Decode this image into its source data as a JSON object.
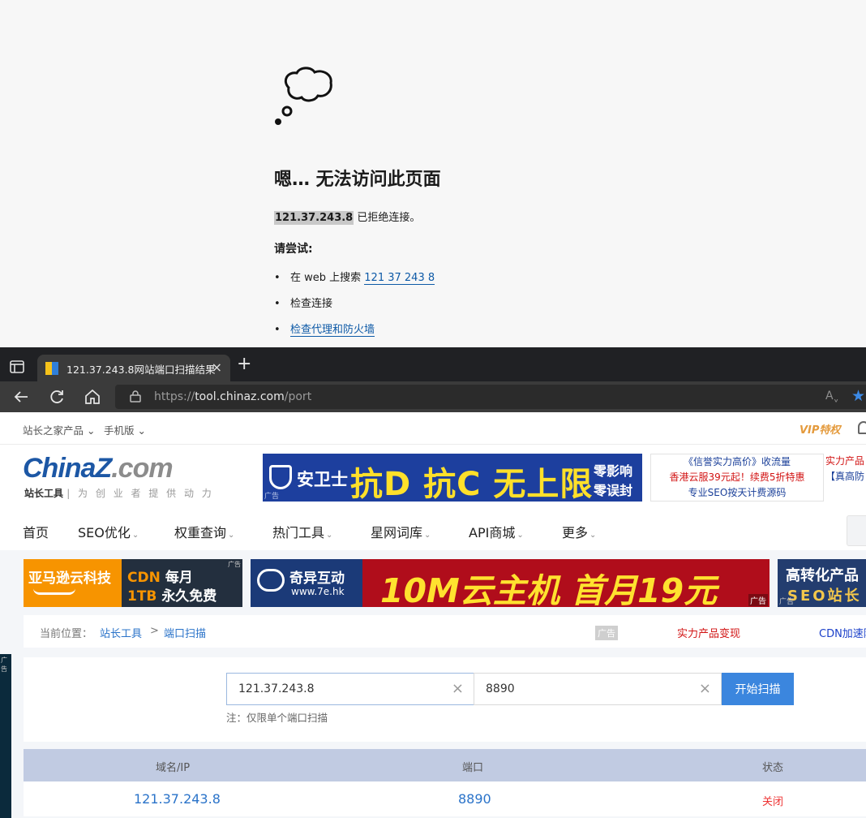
{
  "error_page": {
    "title": "嗯… 无法访问此页面",
    "ip": "121.37.243.8",
    "desc_suffix": " 已拒绝连接。",
    "try_label": "请尝试:",
    "items": [
      {
        "text": "在 web 上搜索 ",
        "link": "121 37 243 8"
      },
      {
        "text": "检查连接",
        "link": ""
      },
      {
        "text": "",
        "link": "检查代理和防火墙"
      }
    ]
  },
  "browser": {
    "tab_title": "121.37.243.8网站端口扫描结果",
    "tab_close": "×",
    "new_tab": "+",
    "url_scheme": "https://",
    "url_host": "tool.chinaz.com",
    "url_path": "/port",
    "read_aloud": "Aˬ",
    "favorite": "★"
  },
  "site": {
    "topstrip": {
      "products": "站长之家产品",
      "mobile": "手机版",
      "vip": "VIP特权"
    },
    "logo": {
      "main": "ChinaZ",
      "com": ".com",
      "name": "站长工具",
      "slogan": "| 为 创 业 者 提 供 动 力"
    },
    "ad_anwei": {
      "brand": "安卫士",
      "headline": "抗D 抗C 无上限",
      "right1": "零影响",
      "right2": "零误封",
      "tag": "广告"
    },
    "ad_text": {
      "line1": "《信誉实力高价》收流量",
      "line2": "香港云服39元起！续费5折特惠",
      "line3": "专业SEO按天计费源码"
    },
    "ad_right": {
      "line1": "实力产品",
      "line2": "【真高防"
    },
    "nav": [
      {
        "label": "首页",
        "dropdown": false
      },
      {
        "label": "SEO优化",
        "dropdown": true
      },
      {
        "label": "权重查询",
        "dropdown": true
      },
      {
        "label": "热门工具",
        "dropdown": true
      },
      {
        "label": "星网词库",
        "dropdown": true
      },
      {
        "label": "API商城",
        "dropdown": true
      },
      {
        "label": "更多",
        "dropdown": true
      }
    ],
    "ad_amz": {
      "left": "亚马逊云科技",
      "cdn": "CDN",
      "monthly": "每月",
      "tb": "1TB",
      "free": "永久免费",
      "tag": "广告"
    },
    "ad_qiyi": {
      "name": "奇异互动",
      "url": "www.7e.hk",
      "headline": "10M云主机  首月19元",
      "tag": "广告"
    },
    "ad_gzh": {
      "line1": "高转化产品",
      "line2": "SEO站长",
      "tag": "广告"
    },
    "side_ad_tag": "广告",
    "breadcrumb": {
      "label": "当前位置：",
      "item1": "站长工具",
      "sep": ">",
      "item2": "端口扫描",
      "ad_tag": "广告",
      "ad1": "实力产品变现",
      "ad2": "CDN加速防"
    },
    "scan": {
      "ip_value": "121.37.243.8",
      "port_value": "8890",
      "clear": "×",
      "button": "开始扫描",
      "note": "注：仅限单个端口扫描"
    },
    "table": {
      "headers": [
        "域名/IP",
        "端口",
        "状态"
      ],
      "rows": [
        {
          "ip": "121.37.243.8",
          "port": "8890",
          "status": "关闭"
        }
      ]
    }
  }
}
